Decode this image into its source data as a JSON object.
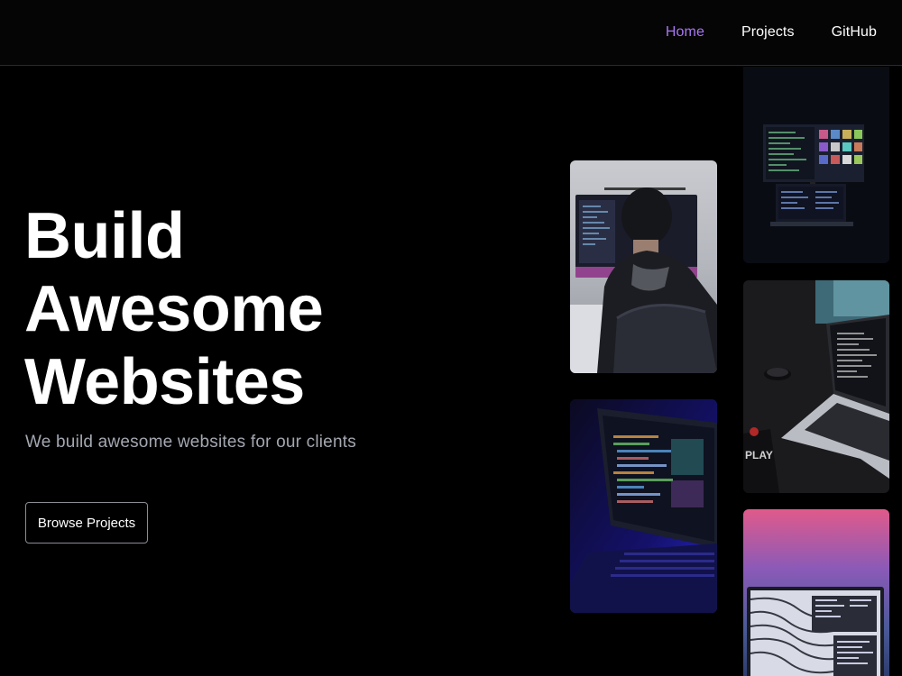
{
  "nav": {
    "items": [
      {
        "label": "Home",
        "active": true
      },
      {
        "label": "Projects",
        "active": false
      },
      {
        "label": "GitHub",
        "active": false
      }
    ],
    "active_color": "#a777f0"
  },
  "hero": {
    "title_lines": [
      "Build",
      "Awesome",
      "Websites"
    ],
    "subtitle": "We build awesome websites for our clients",
    "cta_label": "Browse Projects"
  },
  "gallery": [
    {
      "subject": "person-at-computer-photo"
    },
    {
      "subject": "laptop-code-blue-photo"
    },
    {
      "subject": "monitor-laptop-desk-photo"
    },
    {
      "subject": "laptop-code-desk-photo"
    },
    {
      "subject": "laptop-pink-light-photo"
    }
  ]
}
